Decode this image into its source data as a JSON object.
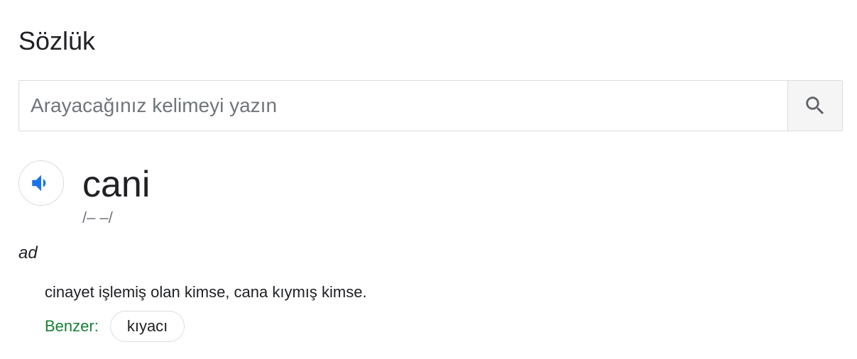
{
  "header": {
    "title": "Sözlük"
  },
  "search": {
    "placeholder": "Arayacağınız kelimeyi yazın",
    "value": "",
    "button_icon": "search-icon"
  },
  "entry": {
    "audio_icon": "speaker-icon",
    "word": "cani",
    "phonetic": "/– –/",
    "part_of_speech": "ad",
    "definition": "cinayet işlemiş olan kimse, cana kıymış kimse.",
    "similar_label": "Benzer:",
    "similar_words": [
      "kıyacı"
    ]
  },
  "colors": {
    "accent_blue": "#1a73e8",
    "similar_green": "#188038",
    "border": "#dadce0"
  }
}
